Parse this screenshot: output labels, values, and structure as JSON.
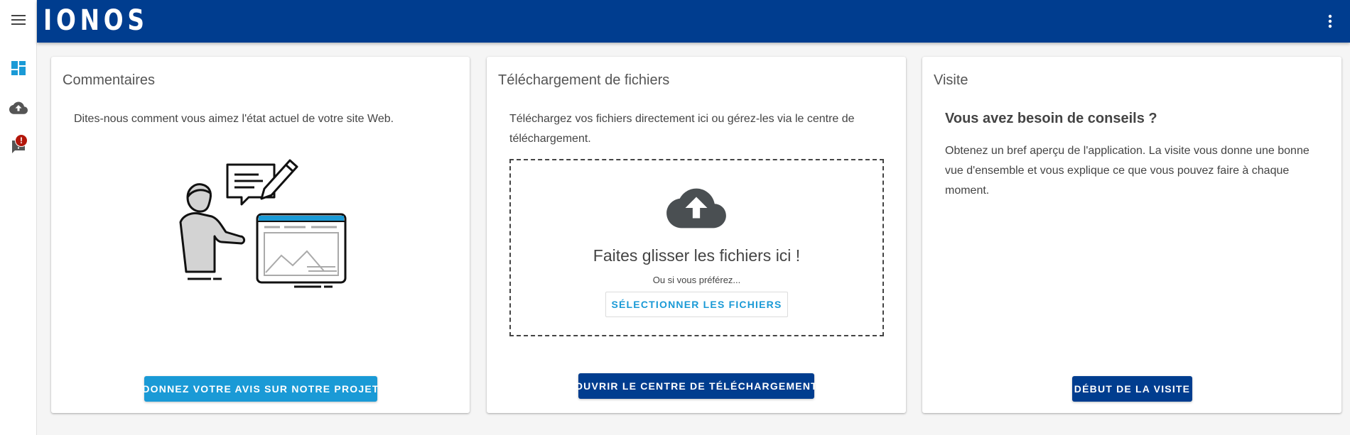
{
  "colors": {
    "header_bg": "#003d8f",
    "accent": "#1a9ad6",
    "primary_button": "#003d8f",
    "badge": "#b3160b"
  },
  "sidebar": {
    "items": [
      {
        "icon": "menu-icon"
      },
      {
        "icon": "dashboard-icon"
      },
      {
        "icon": "cloud-upload-icon"
      },
      {
        "icon": "feedback-icon",
        "badge": "!"
      }
    ]
  },
  "header": {
    "logo_text": "IONOS",
    "menu_icon": "more-vert-icon"
  },
  "cards": {
    "feedback": {
      "title": "Commentaires",
      "text": "Dites-nous comment vous aimez l'état actuel de votre site Web.",
      "button": "DONNEZ VOTRE AVIS SUR NOTRE PROJET"
    },
    "upload": {
      "title": "Téléchargement de fichiers",
      "text": "Téléchargez vos fichiers directement ici ou gérez-les via le centre de téléchargement.",
      "drop_title": "Faites glisser les fichiers ici !",
      "drop_sub": "Ou si vous préférez...",
      "select_button": "SÉLECTIONNER LES FICHIERS",
      "button": "OUVRIR LE CENTRE DE TÉLÉCHARGEMENT"
    },
    "visit": {
      "title": "Visite",
      "heading": "Vous avez besoin de conseils ?",
      "text": "Obtenez un bref aperçu de l'application. La visite vous donne une bonne vue d'ensemble et vous explique ce que vous pouvez faire à chaque moment.",
      "button": "DÉBUT DE LA VISITE"
    }
  }
}
